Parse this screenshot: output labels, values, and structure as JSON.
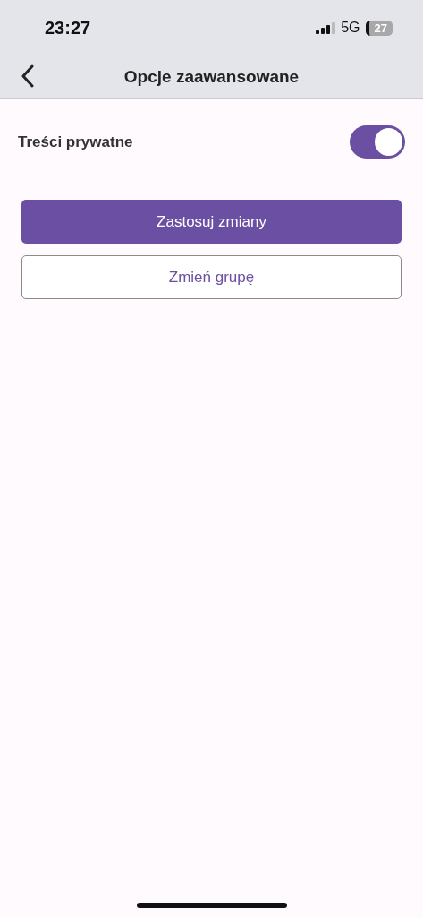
{
  "status_bar": {
    "time": "23:27",
    "network": "5G",
    "battery": "27"
  },
  "header": {
    "title": "Opcje zaawansowane"
  },
  "settings": [
    {
      "label": "Treści prywatne",
      "on": true
    }
  ],
  "buttons": [
    {
      "label": "Zastosuj zmiany",
      "kind": "primary"
    },
    {
      "label": "Zmień grupę",
      "kind": "outline"
    }
  ]
}
